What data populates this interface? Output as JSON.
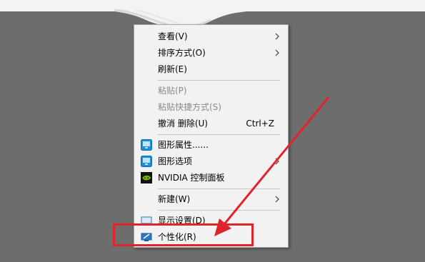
{
  "menu": {
    "items": [
      {
        "label": "查看(V)",
        "submenu": true,
        "icon": null,
        "disabled": false
      },
      {
        "label": "排序方式(O)",
        "submenu": true,
        "icon": null,
        "disabled": false
      },
      {
        "label": "刷新(E)",
        "submenu": false,
        "icon": null,
        "disabled": false
      },
      {
        "label": "粘贴(P)",
        "submenu": false,
        "icon": null,
        "disabled": true
      },
      {
        "label": "粘贴快捷方式(S)",
        "submenu": false,
        "icon": null,
        "disabled": true
      },
      {
        "label": "撤消 删除(U)",
        "shortcut": "Ctrl+Z",
        "submenu": false,
        "icon": null,
        "disabled": false
      },
      {
        "label": "图形属性......",
        "submenu": false,
        "icon": "graphics-properties-icon",
        "disabled": false
      },
      {
        "label": "图形选项",
        "submenu": true,
        "icon": "graphics-options-icon",
        "disabled": false
      },
      {
        "label": "NVIDIA 控制面板",
        "submenu": false,
        "icon": "nvidia-icon",
        "disabled": false
      },
      {
        "label": "新建(W)",
        "submenu": true,
        "icon": null,
        "disabled": false
      },
      {
        "label": "显示设置(D)",
        "submenu": false,
        "icon": "display-settings-icon",
        "disabled": false
      },
      {
        "label": "个性化(R)",
        "submenu": false,
        "icon": "personalize-icon",
        "disabled": false
      }
    ]
  },
  "colors": {
    "desktop": "#6d6d6d",
    "menu_bg": "#f2f2f2",
    "annotation_red": "#e0242b",
    "intel_blue": "#1e8fd6",
    "nvidia_green": "#76b900"
  }
}
